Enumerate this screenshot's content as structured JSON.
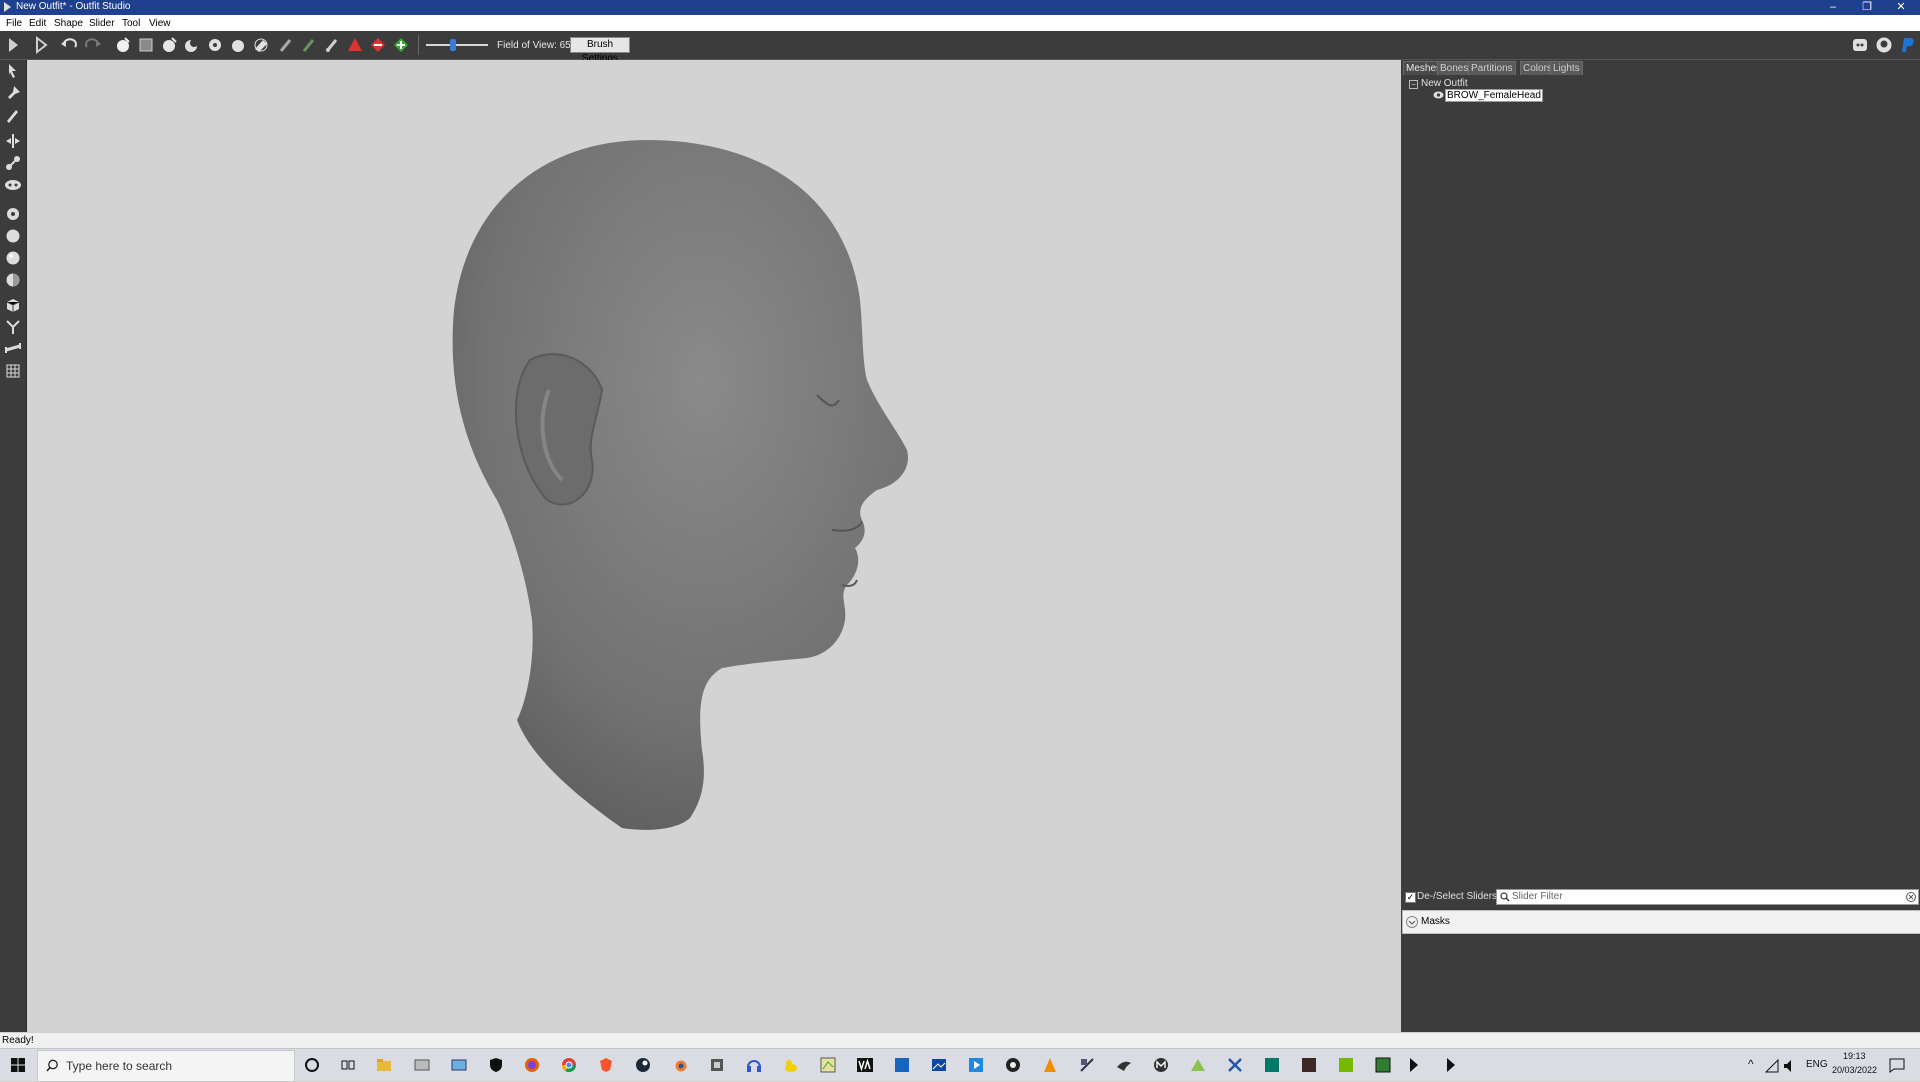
{
  "window": {
    "title": "New Outfit* - Outfit Studio",
    "minimize_glyph": "–",
    "restore_glyph": "❐",
    "close_glyph": "✕"
  },
  "menu": [
    "File",
    "Edit",
    "Shape",
    "Slider",
    "Tool",
    "View"
  ],
  "toolbar": {
    "fov_label": "Field of View: 65",
    "brush_settings_label": "Brush Settings",
    "fov_slider_value": 65
  },
  "right_panel": {
    "tabs": [
      "Meshes",
      "Bones",
      "Partitions",
      "Colors",
      "Lights"
    ],
    "active_tab": "Meshes",
    "tree": {
      "root": "New Outfit",
      "expander_glyph": "−",
      "children": [
        {
          "label": "BROW_FemaleHead",
          "selected": true
        }
      ]
    },
    "slider_controls": {
      "select_all_label": "De-/Select Sliders",
      "select_all_checked": true,
      "filter_placeholder": "Slider Filter"
    },
    "masks_label": "Masks"
  },
  "status": {
    "text": "Ready!"
  },
  "taskbar": {
    "search_placeholder": "Type here to search",
    "language": "ENG",
    "time": "19:13",
    "date": "20/03/2022"
  },
  "colors": {
    "titlebar": "#1f3f8f",
    "toolbar": "#3c3c3c",
    "viewport": "#d3d3d3",
    "panel": "#3c3c3c",
    "head": "#7a7a7a",
    "accent": "#3d7bd6"
  }
}
